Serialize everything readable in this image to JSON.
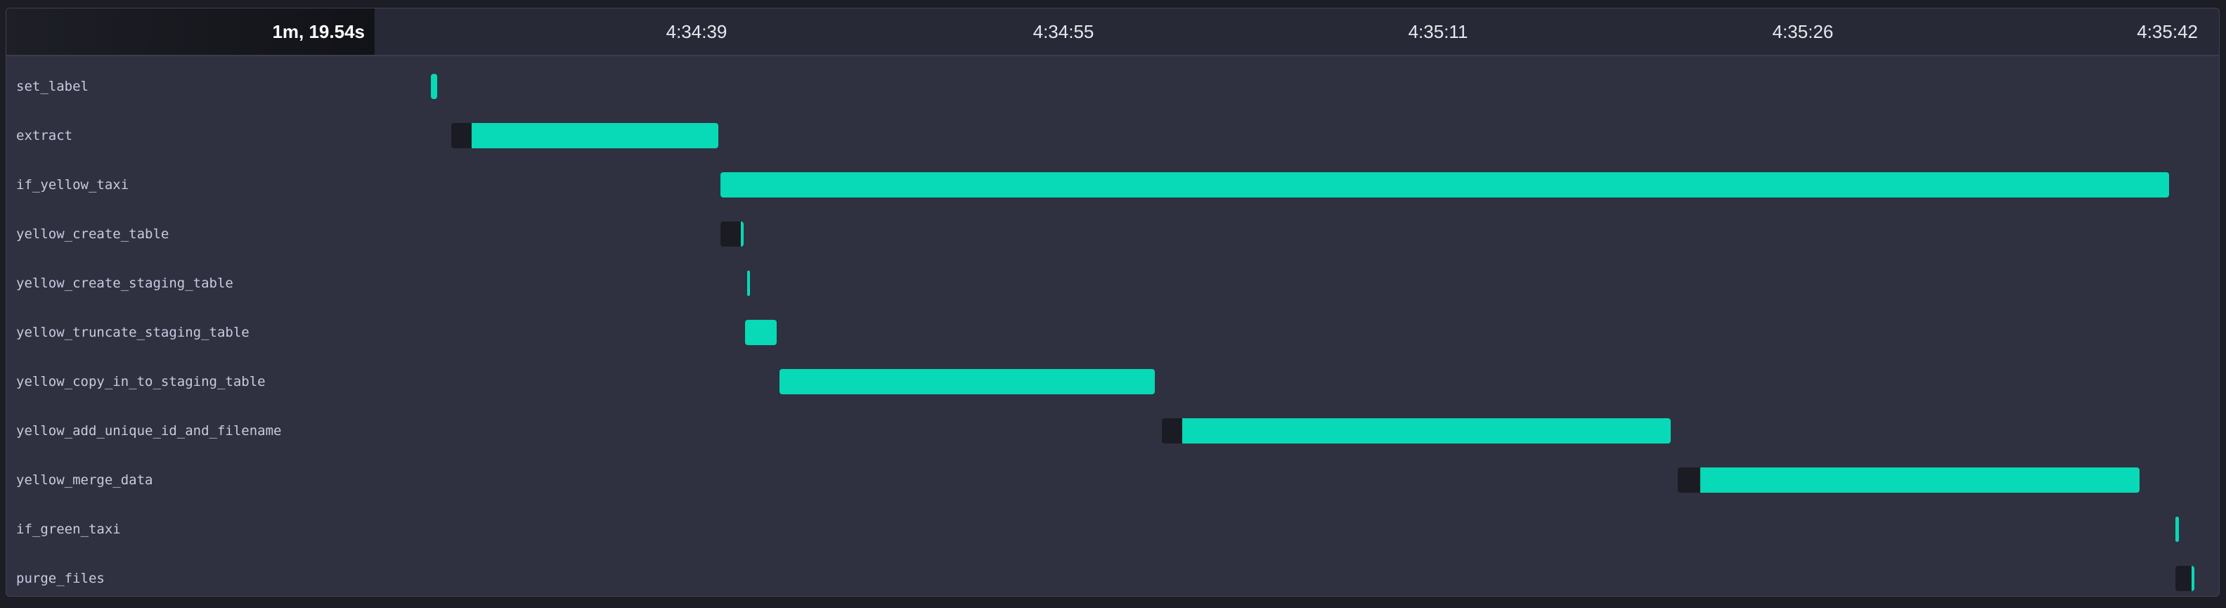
{
  "header": {
    "duration": "1m, 19.54s",
    "ticks": [
      "4:34:39",
      "4:34:55",
      "4:35:11",
      "4:35:26",
      "4:35:42"
    ]
  },
  "colors": {
    "run": "#08d9b6",
    "queued": "#1b1c23",
    "background": "#2f3140"
  },
  "tasks": [
    {
      "name": "set_label",
      "queue_start": 1.2,
      "run_start": 1.2,
      "end": 1.5
    },
    {
      "name": "extract",
      "queue_start": 2.1,
      "run_start": 3.0,
      "end": 13.9
    },
    {
      "name": "if_yellow_taxi",
      "queue_start": 14.0,
      "run_start": 14.0,
      "end": 78.0
    },
    {
      "name": "yellow_create_table",
      "queue_start": 14.0,
      "run_start": 14.9,
      "end": 15.0
    },
    {
      "name": "yellow_create_staging_table",
      "queue_start": 15.2,
      "run_start": 15.2,
      "end": 15.3
    },
    {
      "name": "yellow_truncate_staging_table",
      "queue_start": 15.1,
      "run_start": 15.1,
      "end": 16.5
    },
    {
      "name": "yellow_copy_in_to_staging_table",
      "queue_start": 16.6,
      "run_start": 16.6,
      "end": 33.2
    },
    {
      "name": "yellow_add_unique_id_and_filename",
      "queue_start": 33.5,
      "run_start": 34.4,
      "end": 56.0
    },
    {
      "name": "yellow_merge_data",
      "queue_start": 56.3,
      "run_start": 57.3,
      "end": 76.7
    },
    {
      "name": "if_green_taxi",
      "queue_start": 78.3,
      "run_start": 78.3,
      "end": 78.45
    },
    {
      "name": "purge_files",
      "queue_start": 78.3,
      "run_start": 79.0,
      "end": 79.1
    }
  ]
}
